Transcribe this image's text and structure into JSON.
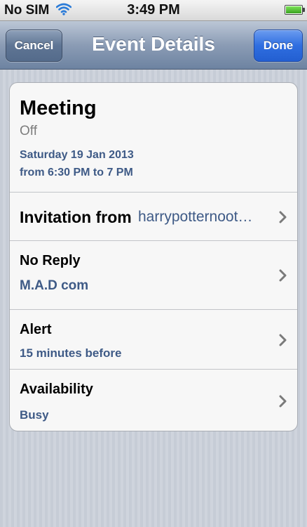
{
  "status_bar": {
    "carrier": "No SIM",
    "time": "3:49 PM",
    "wifi_icon": "wifi-icon",
    "battery_icon": "battery-icon",
    "battery_level": 1.0
  },
  "nav_bar": {
    "title": "Event Details",
    "cancel_label": "Cancel",
    "done_label": "Done"
  },
  "event": {
    "title": "Meeting",
    "status": "Off",
    "date": "Saturday 19 Jan 2013",
    "time_range": "from 6:30 PM to 7 PM"
  },
  "rows": {
    "invitation": {
      "label": "Invitation from",
      "value": "harrypotternoot…"
    },
    "reply": {
      "label": "No Reply",
      "value": "M.A.D com"
    },
    "alert": {
      "label": "Alert",
      "value": "15 minutes before"
    },
    "availability": {
      "label": "Availability",
      "value": "Busy"
    }
  },
  "colors": {
    "accent_text": "#3e5a86",
    "done_button": "#2f6ee0",
    "nav_bar": "#7b8fad"
  }
}
